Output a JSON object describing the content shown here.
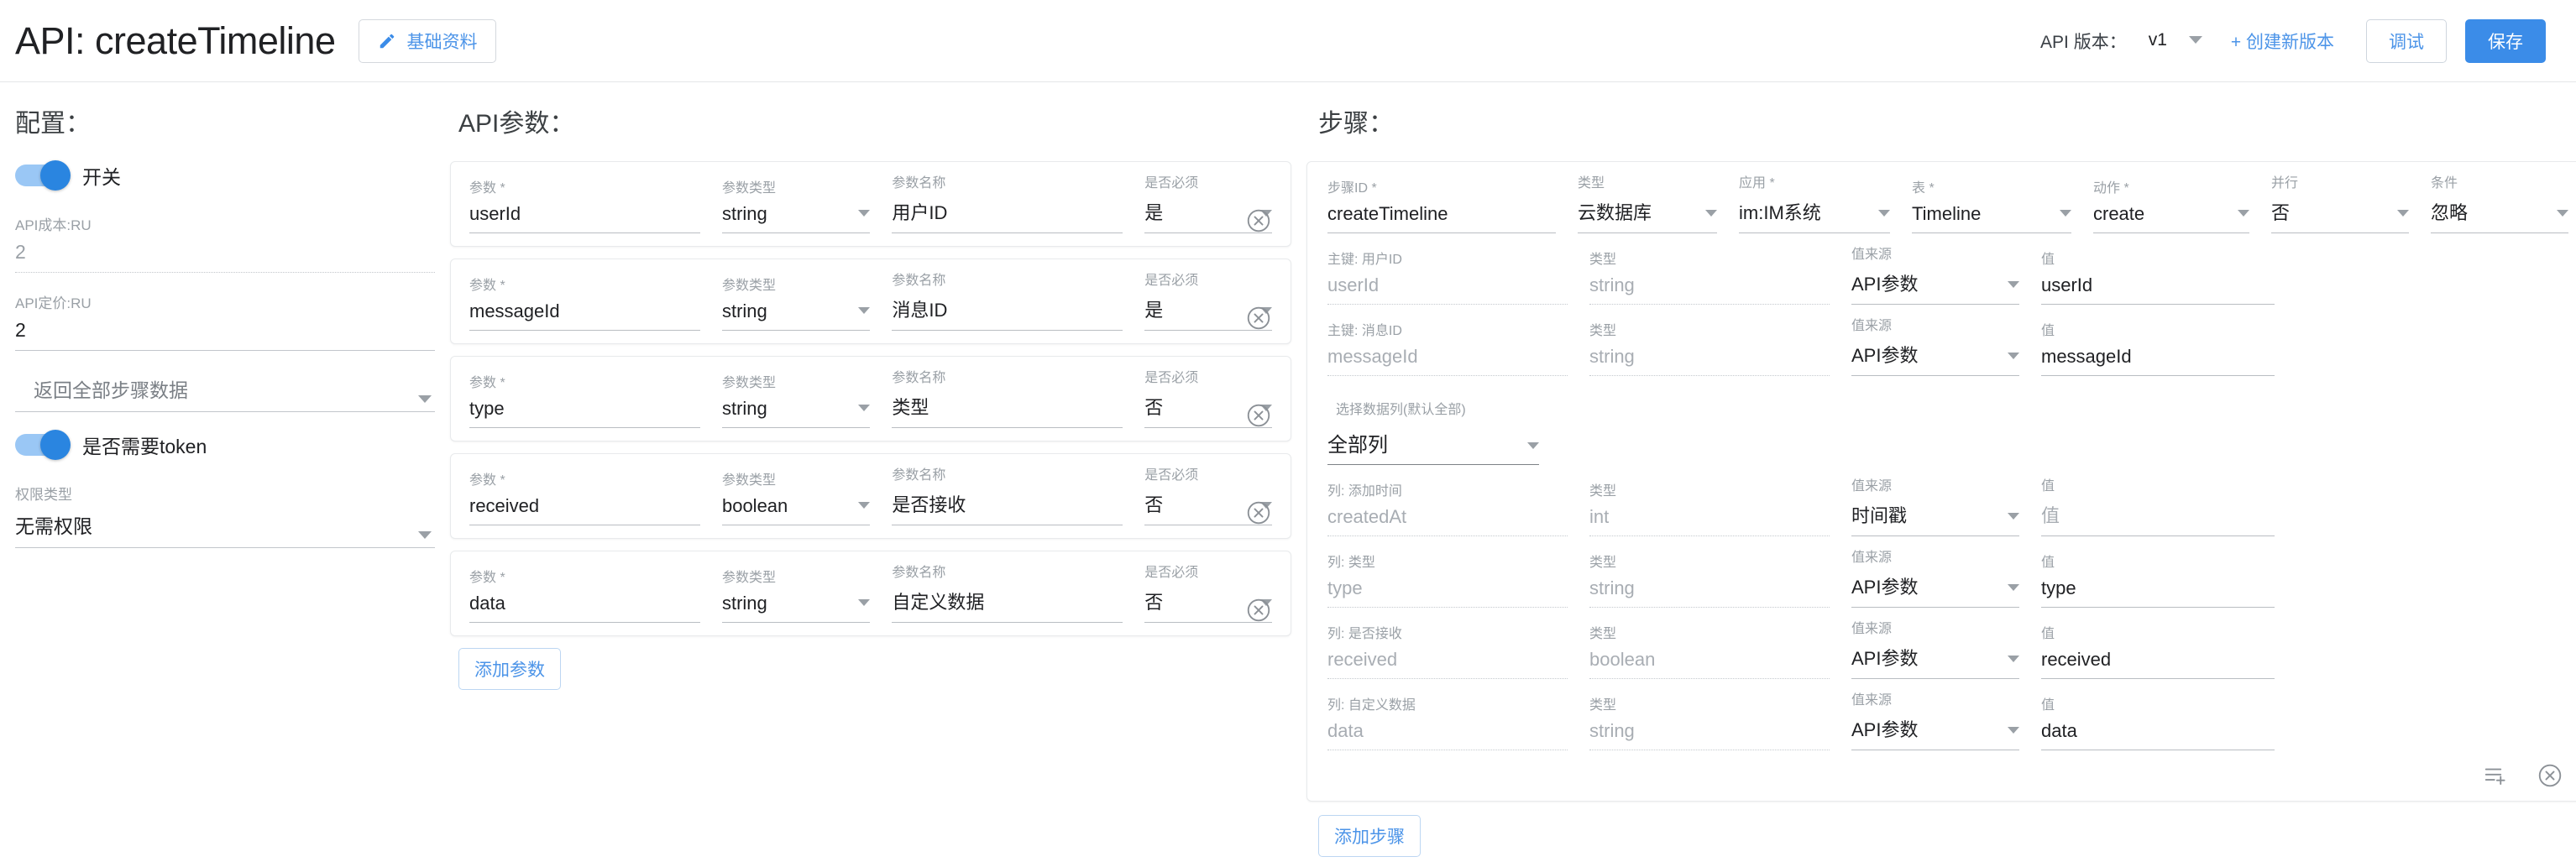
{
  "header": {
    "title": "API: createTimeline",
    "basic_info_label": "基础资料",
    "version_label": "API 版本：",
    "version_value": "v1",
    "create_version_label": "+ 创建新版本",
    "debug_label": "调试",
    "save_label": "保存",
    "accent_color": "#3b8ce8",
    "link_color": "#4c94e8"
  },
  "config": {
    "section_title": "配置：",
    "switch_label": "开关",
    "switch_on": true,
    "cost_label": "API成本:RU",
    "cost_value": "2",
    "price_label": "API定价:RU",
    "price_value": "2",
    "return_mode_value": "返回全部步骤数据",
    "token_label": "是否需要token",
    "token_on": true,
    "auth_label": "权限类型",
    "auth_value": "无需权限"
  },
  "params": {
    "section_title": "API参数：",
    "labels": {
      "name": "参数",
      "type": "参数类型",
      "display": "参数名称",
      "required": "是否必须",
      "required_marker": "*"
    },
    "add_label": "添加参数",
    "rows": [
      {
        "name": "userId",
        "type": "string",
        "display": "用户ID",
        "required": "是"
      },
      {
        "name": "messageId",
        "type": "string",
        "display": "消息ID",
        "required": "是"
      },
      {
        "name": "type",
        "type": "string",
        "display": "类型",
        "required": "否"
      },
      {
        "name": "received",
        "type": "boolean",
        "display": "是否接收",
        "required": "否"
      },
      {
        "name": "data",
        "type": "string",
        "display": "自定义数据",
        "required": "否"
      }
    ]
  },
  "steps": {
    "section_title": "步骤：",
    "add_label": "添加步骤",
    "header_labels": {
      "step_id": "步骤ID",
      "type": "类型",
      "app": "应用",
      "table": "表",
      "action": "动作",
      "parallel": "并行",
      "condition": "条件",
      "required_marker": "*"
    },
    "header_values": {
      "step_id": "createTimeline",
      "type": "云数据库",
      "app": "im:IM系统",
      "table": "Timeline",
      "action": "create",
      "parallel": "否",
      "condition": "忽略"
    },
    "sub_labels": {
      "type": "类型",
      "source": "值来源",
      "value": "值"
    },
    "keys": [
      {
        "label": "主键: 用户ID",
        "name": "userId",
        "type": "string",
        "source": "API参数",
        "value": "userId"
      },
      {
        "label": "主键: 消息ID",
        "name": "messageId",
        "type": "string",
        "source": "API参数",
        "value": "messageId"
      }
    ],
    "column_select": {
      "label": "选择数据列(默认全部)",
      "value": "全部列"
    },
    "columns": [
      {
        "label": "列: 添加时间",
        "name": "createdAt",
        "type": "int",
        "source": "时间戳",
        "value": "值",
        "value_is_placeholder": true
      },
      {
        "label": "列: 类型",
        "name": "type",
        "type": "string",
        "source": "API参数",
        "value": "type",
        "value_is_placeholder": false
      },
      {
        "label": "列: 是否接收",
        "name": "received",
        "type": "boolean",
        "source": "API参数",
        "value": "received",
        "value_is_placeholder": false
      },
      {
        "label": "列: 自定义数据",
        "name": "data",
        "type": "string",
        "source": "API参数",
        "value": "data",
        "value_is_placeholder": false
      }
    ]
  }
}
